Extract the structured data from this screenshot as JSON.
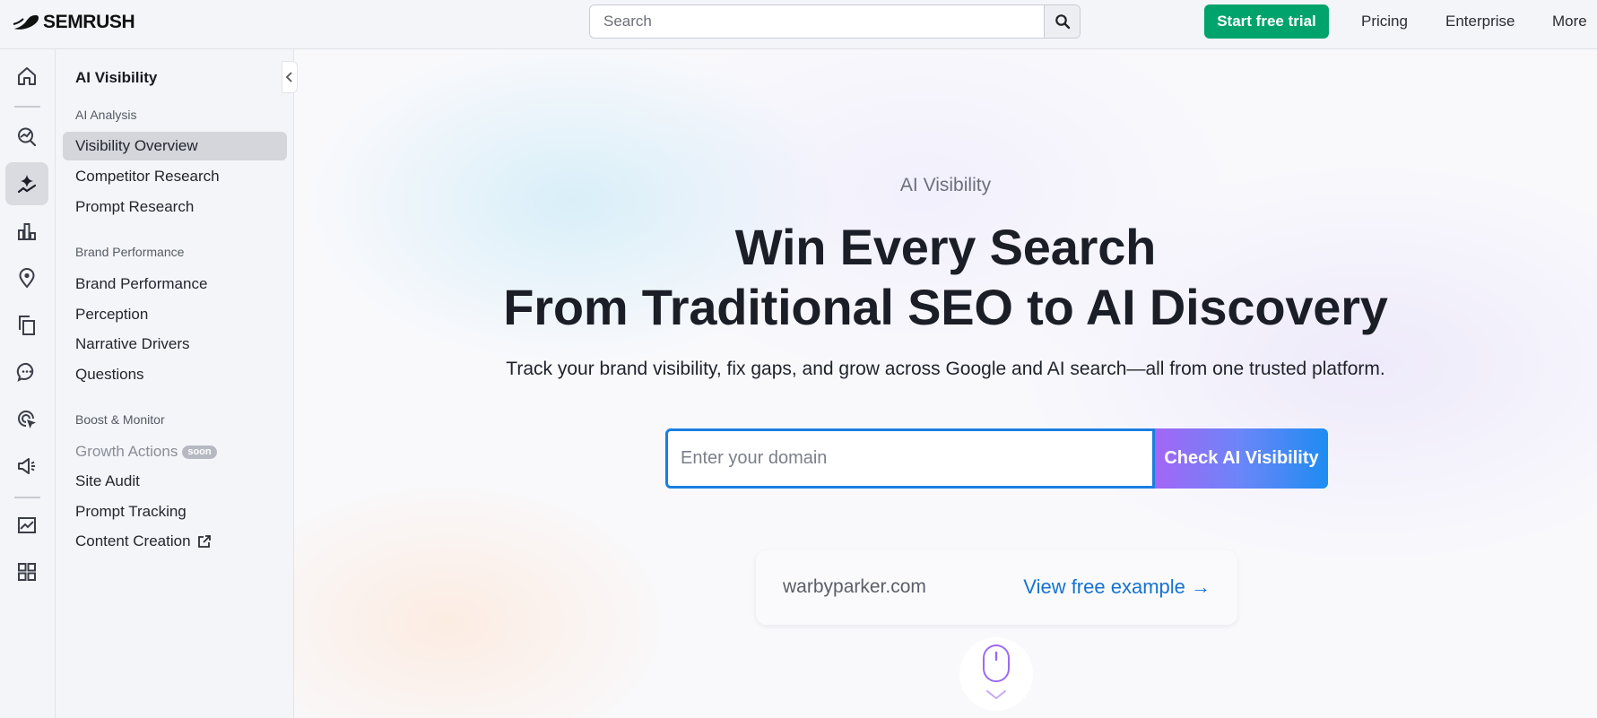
{
  "header": {
    "logo_text": "SEMRUSH",
    "search_placeholder": "Search",
    "trial_label": "Start free trial",
    "nav": [
      "Pricing",
      "Enterprise",
      "More"
    ]
  },
  "rail": {
    "icons": [
      "home-icon",
      "trends-search-icon",
      "ai-visibility-icon",
      "bar-chart-icon",
      "location-pin-icon",
      "copy-pages-icon",
      "chat-bubble-icon",
      "cursor-click-icon",
      "megaphone-icon",
      "line-chart-icon",
      "apps-grid-icon"
    ],
    "active": "ai-visibility-icon"
  },
  "sidebar": {
    "title": "AI Visibility",
    "sections": [
      {
        "label": "AI Analysis",
        "items": [
          "Visibility Overview",
          "Competitor Research",
          "Prompt Research"
        ]
      },
      {
        "label": "Brand Performance",
        "items": [
          "Brand Performance",
          "Perception",
          "Narrative Drivers",
          "Questions"
        ]
      },
      {
        "label": "Boost & Monitor",
        "items": [
          "Growth Actions",
          "Site Audit",
          "Prompt Tracking",
          "Content Creation"
        ]
      }
    ],
    "selected_item": "Visibility Overview",
    "soon_badge": "soon"
  },
  "hero": {
    "eyebrow": "AI Visibility",
    "headline_line1": "Win Every Search",
    "headline_line2": "From Traditional SEO to AI Discovery",
    "subline": "Track your brand visibility, fix gaps, and grow across Google and AI search—all from one trusted platform.",
    "domain_placeholder": "Enter your domain",
    "check_button": "Check AI Visibility",
    "example_domain": "warbyparker.com",
    "example_link": "View free example →"
  },
  "colors": {
    "accent_green": "#00a36c",
    "link_blue": "#1673cf",
    "input_border": "#1a7ee0",
    "gradient_start": "#a266f5",
    "gradient_end": "#1e8cf2"
  }
}
